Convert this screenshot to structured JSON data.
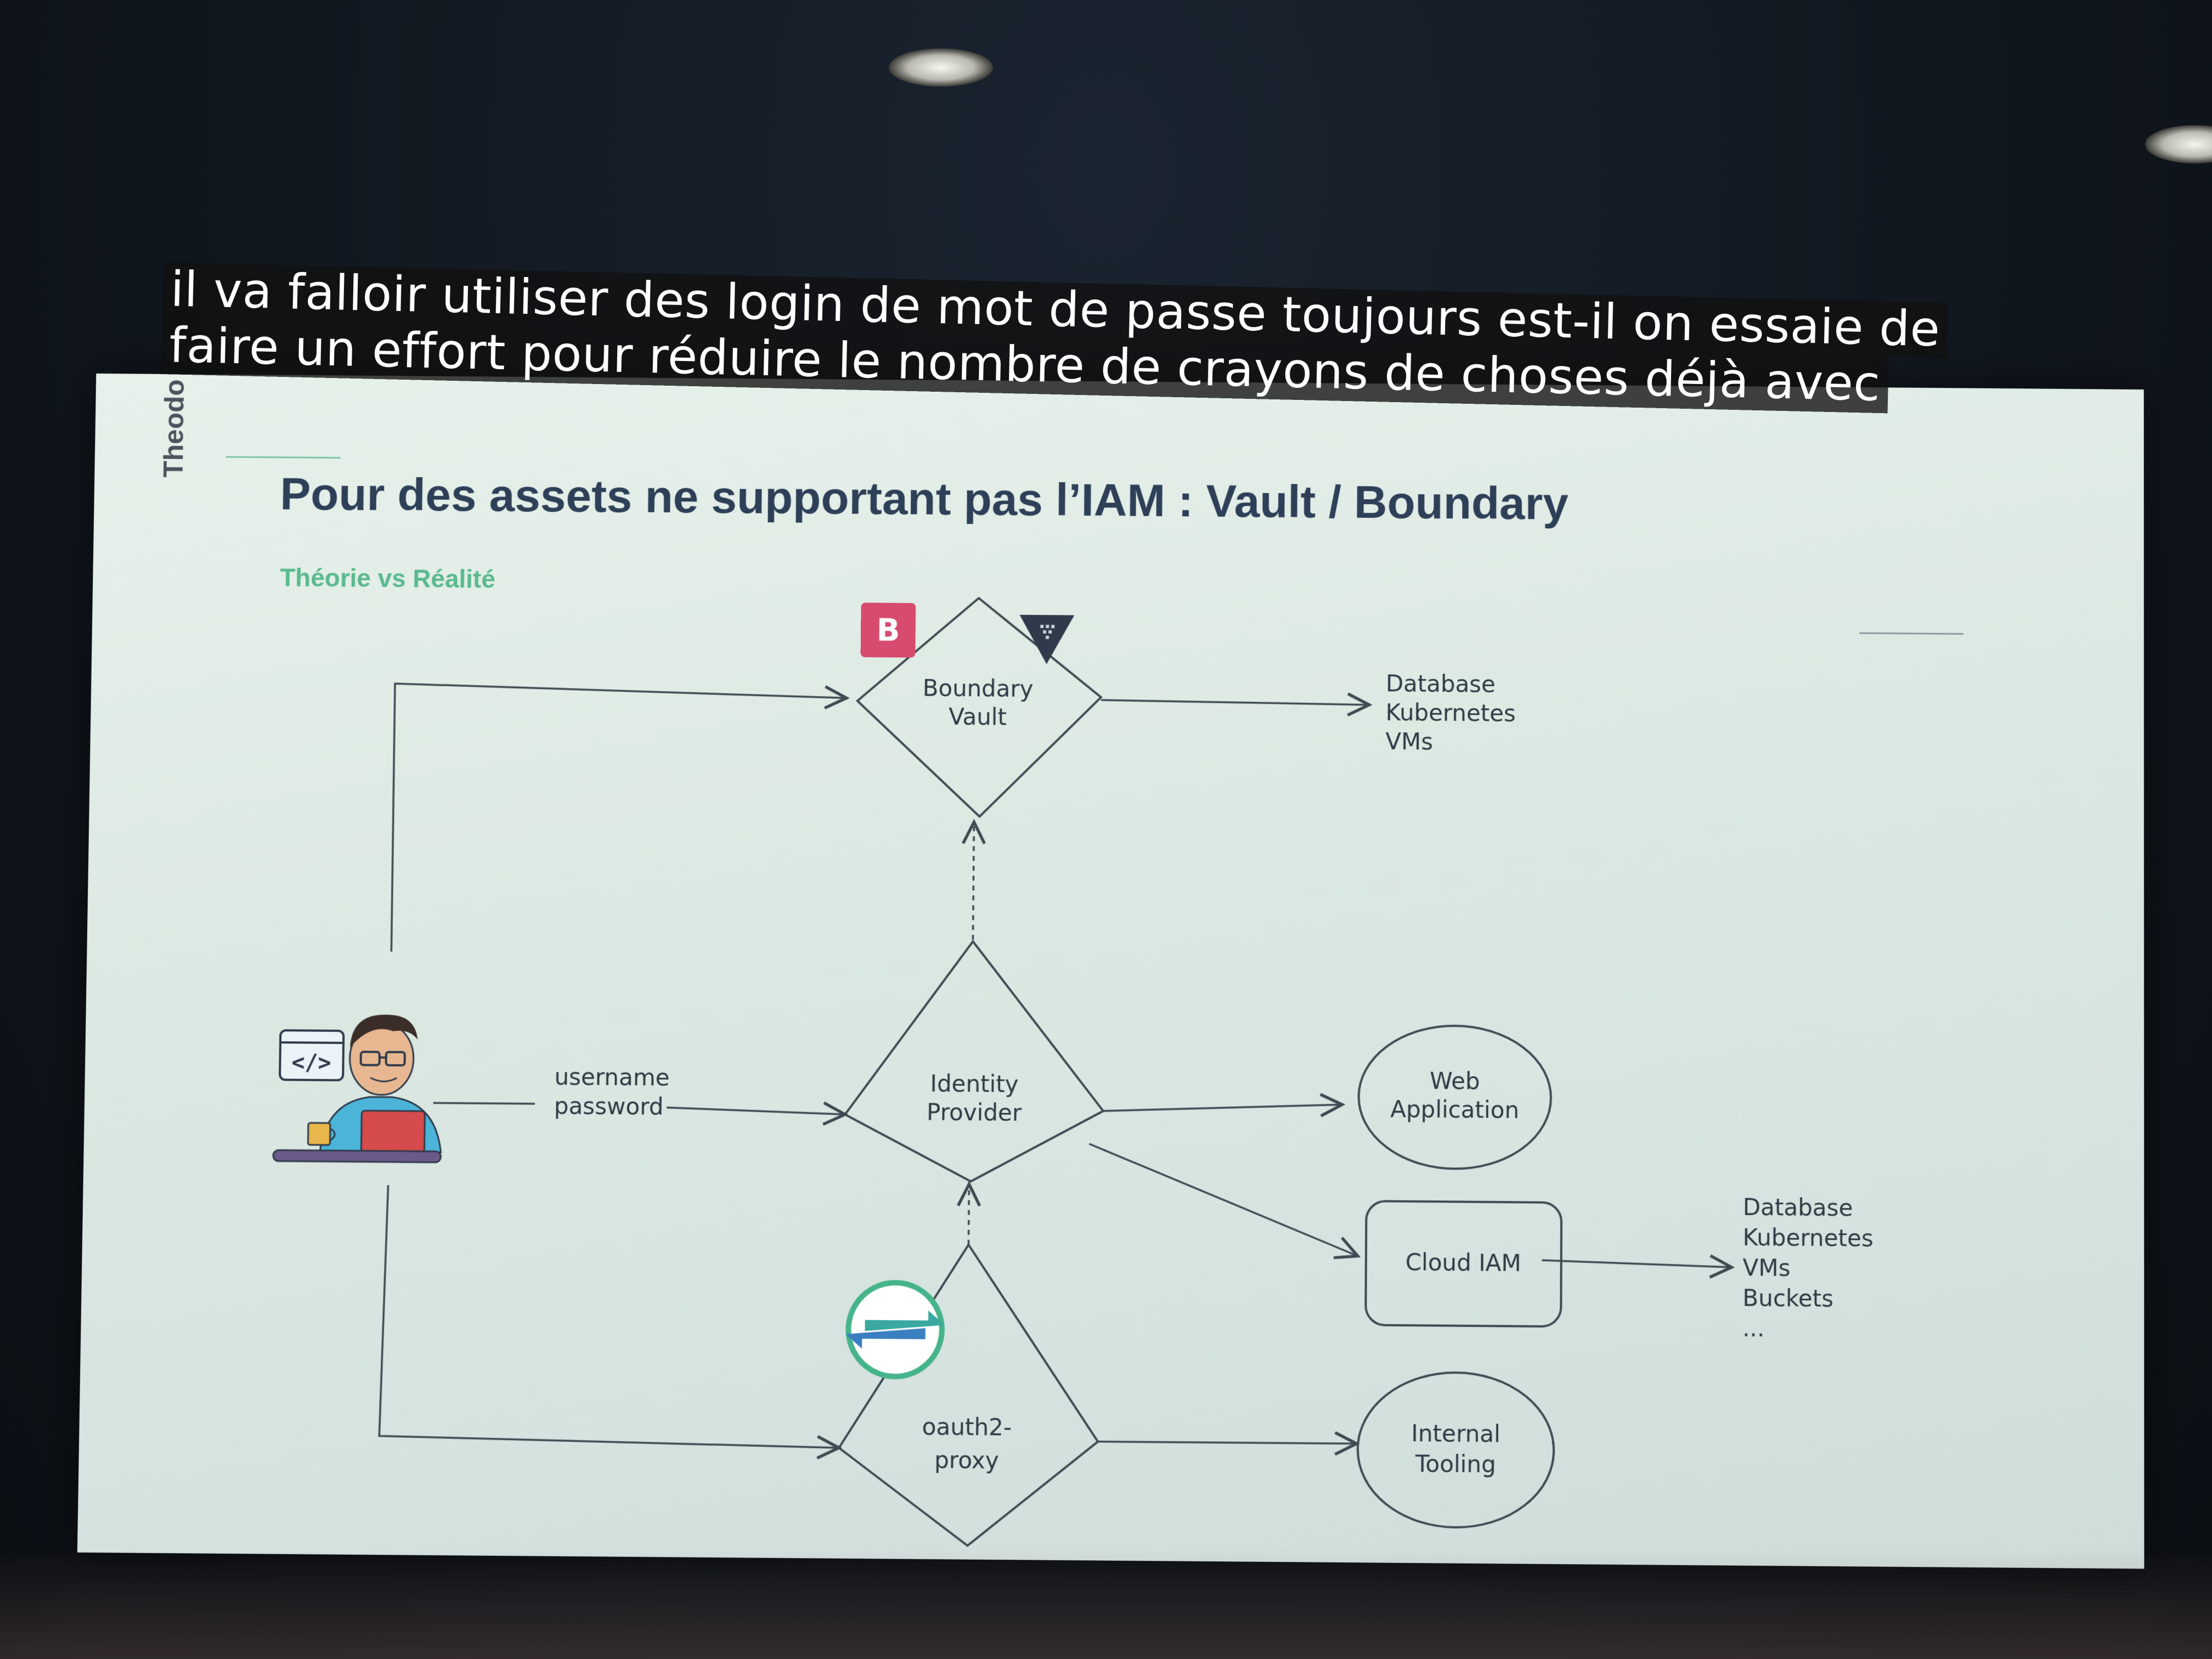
{
  "caption": {
    "line1": "il va falloir utiliser des login de mot de passe toujours est-il on essaie de",
    "line2": "faire un effort pour réduire le nombre de crayons de choses déjà avec"
  },
  "slide": {
    "brand": "Theodo",
    "title": "Pour des assets ne supportant pas l’IAM : Vault / Boundary",
    "subtitle": "Théorie vs Réalité"
  },
  "diagram": {
    "developer_icon": "developer-at-laptop-icon",
    "code_icon_text": "</>",
    "credentials_label": [
      "username",
      "password"
    ],
    "boundary_vault": {
      "label": [
        "Boundary",
        "Vault"
      ],
      "boundary_logo_text": "B",
      "vault_logo": "vault-triangle-icon"
    },
    "boundary_targets": [
      "Database",
      "Kubernetes",
      "VMs"
    ],
    "identity_provider": {
      "label": [
        "Identity",
        "Provider"
      ]
    },
    "web_application": {
      "label": [
        "Web",
        "Application"
      ]
    },
    "cloud_iam": {
      "label": "Cloud IAM"
    },
    "cloud_targets": [
      "Database",
      "Kubernetes",
      "VMs",
      "Buckets",
      "..."
    ],
    "oauth2_proxy": {
      "label": [
        "oauth2-",
        "proxy"
      ],
      "logo": "oauth2-proxy-arrows-icon"
    },
    "internal_tooling": {
      "label": [
        "Internal",
        "Tooling"
      ]
    }
  },
  "colors": {
    "boundary_logo": "#d64b6e",
    "vault_logo": "#2f3a4a",
    "title": "#2e3f58",
    "subtitle": "#5ab98e",
    "oauth2_ring": "#46b48a",
    "oauth2_arrow_teal": "#3aa8a0",
    "oauth2_arrow_blue": "#3a7fc0"
  }
}
